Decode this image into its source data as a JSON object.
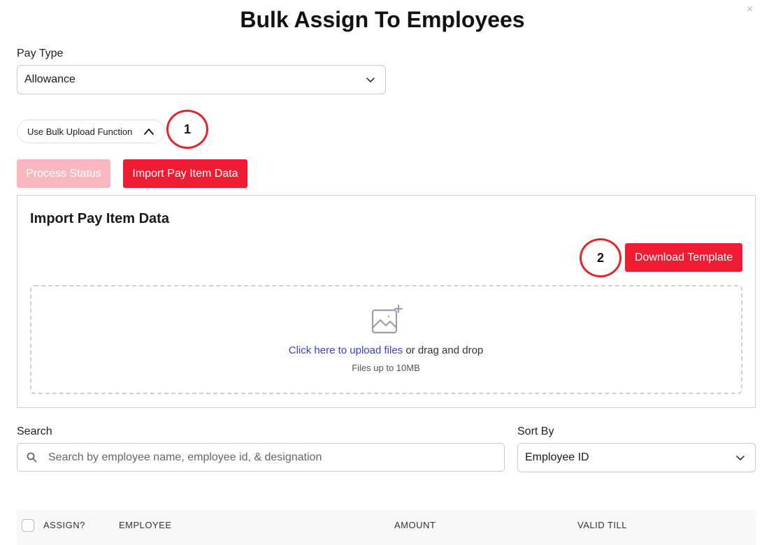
{
  "modal": {
    "title": "Bulk Assign To Employees",
    "close_glyph": "×"
  },
  "pay_type": {
    "label": "Pay Type",
    "value": "Allowance"
  },
  "bulk_upload": {
    "toggle_label": "Use Bulk Upload Function",
    "expanded": true
  },
  "markers": [
    "1",
    "2"
  ],
  "actions": {
    "process_status": "Process Status",
    "import_pay_item": "Import Pay Item Data"
  },
  "import_panel": {
    "title": "Import Pay Item Data",
    "download_template": "Download Template",
    "dropzone": {
      "link": "Click here to upload files",
      "rest": " or drag and drop",
      "hint": "Files up to 10MB"
    }
  },
  "search": {
    "label": "Search",
    "placeholder": "Search by employee name, employee id, & designation",
    "value": ""
  },
  "sort": {
    "label": "Sort By",
    "value": "Employee ID"
  },
  "table": {
    "headers": [
      "Assign?",
      "Employee",
      "Amount",
      "Valid Till"
    ]
  },
  "icons": [
    "close-icon",
    "chevron-down-icon",
    "chevron-up-icon",
    "image-upload-icon",
    "search-icon",
    "checkbox-icon"
  ],
  "colors": {
    "primary": "#f01c33",
    "primary_disabled": "#f9b8c0",
    "link": "#3b3bd6",
    "marker": "#e0262b"
  }
}
